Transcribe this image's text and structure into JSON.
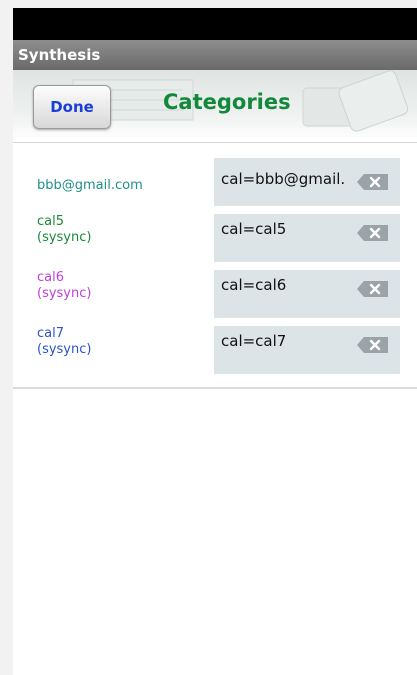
{
  "app": {
    "title": "Synthesis"
  },
  "header": {
    "done_label": "Done",
    "title": "Categories"
  },
  "colors": {
    "title_green": "#12893a",
    "done_blue": "#1a3fd6",
    "teal": "#1f8f8a",
    "green": "#1a8a3a",
    "magenta": "#c040d8",
    "blue": "#2a55c8"
  },
  "rows": [
    {
      "account": "bbb@gmail.com",
      "sub": "",
      "value": "cal=bbb@gmail.",
      "color": "#1f8f8a",
      "delete_icon": "backspace-delete-icon"
    },
    {
      "account": "cal5",
      "sub": "(sysync)",
      "value": "cal=cal5",
      "color": "#1a8a3a",
      "delete_icon": "backspace-delete-icon"
    },
    {
      "account": "cal6",
      "sub": "(sysync)",
      "value": "cal=cal6",
      "color": "#c040d8",
      "delete_icon": "backspace-delete-icon"
    },
    {
      "account": "cal7",
      "sub": "(sysync)",
      "value": "cal=cal7",
      "color": "#2a55c8",
      "delete_icon": "backspace-delete-icon"
    }
  ]
}
